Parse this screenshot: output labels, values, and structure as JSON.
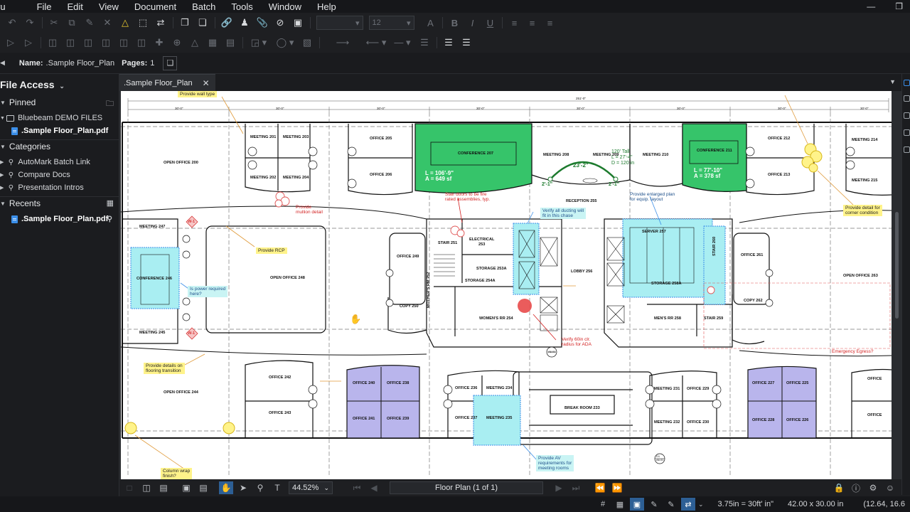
{
  "menu": [
    "ru",
    "File",
    "Edit",
    "View",
    "Document",
    "Batch",
    "Tools",
    "Window",
    "Help"
  ],
  "toolbar": {
    "font_name": "",
    "font_size": "12"
  },
  "properties": {
    "name_label": "Name:",
    "name_value": ".Sample Floor_Plan",
    "pages_label": "Pages:",
    "pages_value": "1"
  },
  "left_panel": {
    "title": "File Access",
    "pinned": {
      "label": "Pinned",
      "folder": "Bluebeam DEMO FILES",
      "file": ".Sample Floor_Plan.pdf"
    },
    "categories": {
      "label": "Categories",
      "items": [
        "AutoMark Batch Link",
        "Compare Docs",
        "Presentation Intros"
      ]
    },
    "recents": {
      "label": "Recents",
      "file": ".Sample Floor_Plan.pdf"
    }
  },
  "tab": {
    "label": ".Sample Floor_Plan"
  },
  "plan": {
    "rooms": {
      "open_office_200": "OPEN OFFICE  200",
      "meeting_201": "MEETING  201",
      "meeting_203": "MEETING  203",
      "meeting_202": "MEETING  202",
      "meeting_204": "MEETING  204",
      "office_205": "OFFICE  205",
      "office_206": "OFFICE  206",
      "conference_207": "CONFERENCE  207",
      "meeting_208": "MEETING  208",
      "meeting_209": "MEETING  209",
      "meeting_210": "MEETING  210",
      "conference_211": "CONFERENCE  211",
      "office_212": "OFFICE  212",
      "office_213": "OFFICE  213",
      "meeting_214": "MEETING  214",
      "meeting_215": "MEETING  215",
      "reception_255": "RECEPTION  255",
      "meeting_247": "MEETING  247",
      "conference_246": "CONFERENCE  246",
      "meeting_245": "MEETING  245",
      "open_office_248": "OPEN OFFICE  248",
      "office_249": "OFFICE  249",
      "copy_250": "COPY  250",
      "stair_251": "STAIR  251",
      "electrical_253": "ELECTRICAL\n253",
      "storage_253a": "STORAGE  253A",
      "storage_254a": "STORAGE  254A",
      "mothers_rm_252": "MOTHER'S RM 252",
      "womens_rr_254": "WOMEN'S RR  254",
      "lobby_256": "LOBBY  256",
      "server_257": "SERVER  257",
      "storage_258a": "STORAGE  258A",
      "mens_rr_258": "MEN'S RR  258",
      "stair_259": "STAIR  259",
      "stair_260": "STAIR 260",
      "office_261": "OFFICE  261",
      "copy_262": "COPY  262",
      "open_office_263": "OPEN OFFICE  263",
      "open_office_244": "OPEN OFFICE  244",
      "office_242": "OFFICE  242",
      "office_243": "OFFICE  243",
      "office_240": "OFFICE  240",
      "office_238": "OFFICE  238",
      "office_241": "OFFICE  241",
      "office_239": "OFFICE  239",
      "office_236": "OFFICE  236",
      "office_237": "OFFICE  237",
      "meeting_234": "MEETING  234",
      "meeting_235": "MEETING  235",
      "break_room_233": "BREAK ROOM  233",
      "meeting_231": "MEETING  231",
      "meeting_232": "MEETING  232",
      "office_229": "OFFICE  229",
      "office_230": "OFFICE  230",
      "office_227": "OFFICE  227",
      "office_225": "OFFICE  225",
      "office_228": "OFFICE  228",
      "office_226": "OFFICE  226",
      "office_r1": "OFFICE",
      "office_r2": "OFFICE"
    },
    "measures": {
      "conf207": "L = 106'-9\"\nA = 649 sf",
      "conf211": "L = 77'-10\"\nA = 378 sf",
      "arc": "23'-2\"",
      "arc_l": "2'-1\"",
      "arc_r": "2'-1\"",
      "height": "120' Tall\nL = 27'-4\"\nD = 120 in"
    },
    "callouts": {
      "wall_type": "Provide wall type",
      "mullion": "Provide\nmullion detail",
      "stair_doors": "Stair doors to be fire\nrated assemblies, typ.",
      "ducting": "Verify all ducting will\nfit in this chase",
      "enlarged": "Provide enlarged plan\nfor equip. layout",
      "corner": "Provide detail for\ncorner condition",
      "rcp": "Provide RCP",
      "power": "Is power required\nhere?",
      "ada": "Verify 60in clr.\nradius for ADA",
      "egress": "Emergency Egress?",
      "flooring": "Provide details on\nflooring transition",
      "av": "Provide AV\nrequirements for\nmeeting rooms",
      "column": "Column wrap\nfinish?"
    },
    "tags": {
      "w1a": "W-1",
      "w1b": "W-1",
      "a6": "A6.01",
      "d1": "D1\nA6.01"
    },
    "dims": [
      "251'-0\"",
      "30'-0\"",
      "30'-0\"",
      "30'-0\"",
      "30'-0\"",
      "30'-0\"",
      "30'-0\"",
      "30'-0\"",
      "30'-0\""
    ]
  },
  "nav": {
    "zoom": "44.52%",
    "page": "Floor Plan (1 of 1)"
  },
  "status": {
    "scale": "3.75in = 30ft' in\"",
    "size": "42.00 x 30.00 in",
    "coords": "(12.64, 16.6"
  },
  "colors": {
    "green_fill": "#36c46a",
    "cyan_fill": "#a9eef2",
    "purple_fill": "#b9b5ec",
    "yellow_fill": "#fff38a",
    "accent": "#3b8ee8"
  }
}
